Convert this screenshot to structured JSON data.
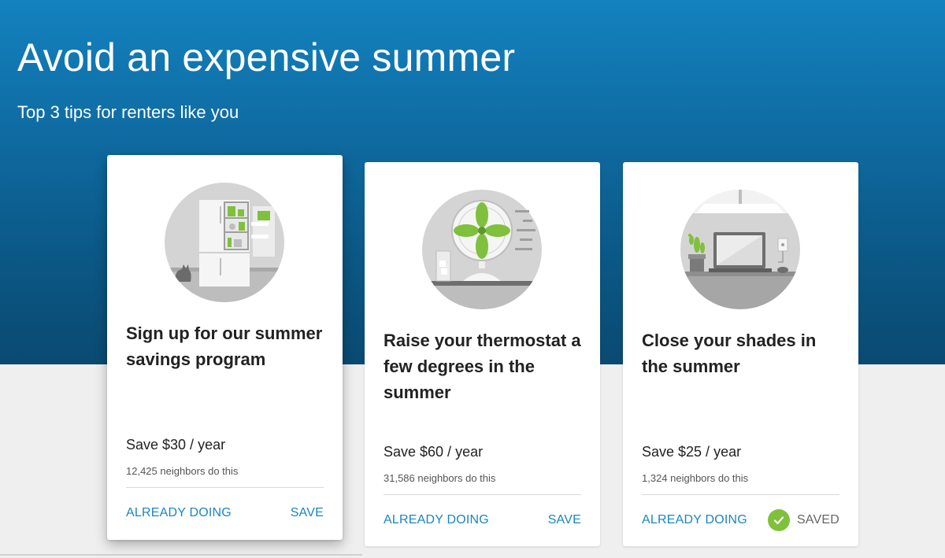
{
  "hero": {
    "title": "Avoid an expensive summer",
    "subtitle": "Top 3 tips for renters like you"
  },
  "colors": {
    "hero_top": "#1382bf",
    "hero_bottom": "#0a4a72",
    "link": "#1a86c1",
    "saved_check": "#7fc03d",
    "illustration_green": "#7fc03d",
    "page_bg": "#efefef"
  },
  "cards": [
    {
      "illustration": "refrigerator-illustration",
      "title": "Sign up for our summer savings program",
      "save": "Save $30 / year",
      "neighbors": "12,425 neighbors do this",
      "already_label": "ALREADY DOING",
      "action_label": "SAVE",
      "saved": false
    },
    {
      "illustration": "fan-illustration",
      "title": "Raise your thermostat a few degrees in the summer",
      "save": "Save $60 / year",
      "neighbors": "31,586 neighbors do this",
      "already_label": "ALREADY DOING",
      "action_label": "SAVE",
      "saved": false
    },
    {
      "illustration": "laptop-desk-illustration",
      "title": "Close your shades in the summer",
      "save": "Save $25 / year",
      "neighbors": "1,324 neighbors do this",
      "already_label": "ALREADY DOING",
      "action_label": "SAVED",
      "saved": true,
      "saved_icon": "check-icon"
    }
  ]
}
